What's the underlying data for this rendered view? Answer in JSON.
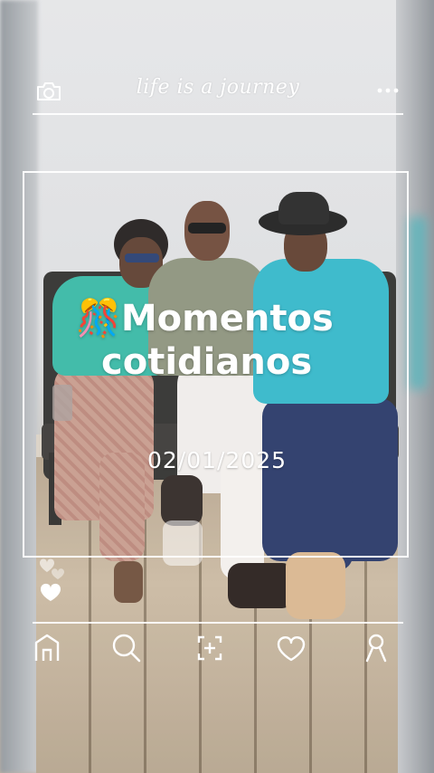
{
  "header": {
    "title": "life is a journey",
    "left_icon": "camera-icon",
    "right_icon": "more-dots-icon"
  },
  "post": {
    "heading_emoji": "🎊",
    "heading_line1": "Momentos",
    "heading_line2": "cotidianos",
    "date": "02/01/2025"
  },
  "reactions": {
    "icons": [
      "small-heart-icon",
      "small-heart-icon",
      "heart-icon"
    ]
  },
  "bottom_nav": {
    "items": [
      {
        "icon": "home-icon"
      },
      {
        "icon": "search-icon"
      },
      {
        "icon": "add-post-icon"
      },
      {
        "icon": "heart-icon"
      },
      {
        "icon": "profile-icon"
      }
    ]
  },
  "colors": {
    "overlay": "#ffffff",
    "shirt_teal": "#33b7a3",
    "shirt_blue": "#2fb6c8",
    "shirt_olive": "#8a917a"
  }
}
